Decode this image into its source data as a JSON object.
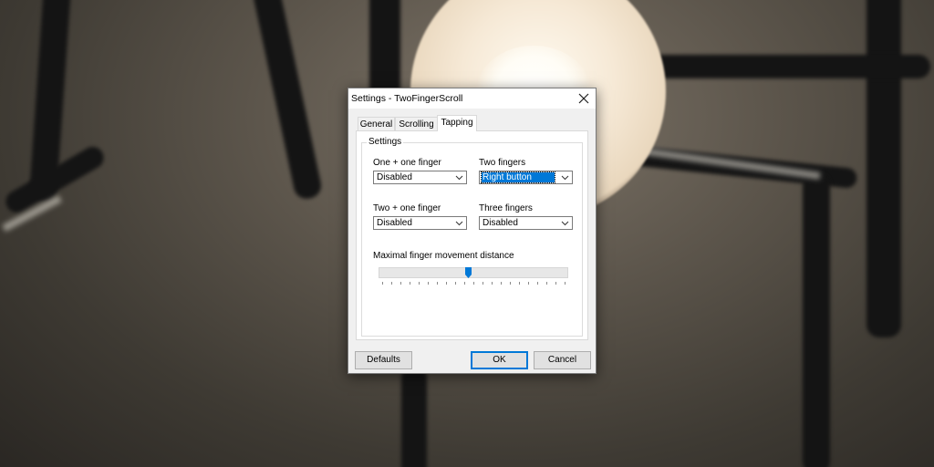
{
  "window": {
    "title": "Settings - TwoFingerScroll",
    "close_icon": "close-icon"
  },
  "tabs": [
    {
      "label": "General",
      "active": false
    },
    {
      "label": "Scrolling",
      "active": false
    },
    {
      "label": "Tapping",
      "active": true
    }
  ],
  "group": {
    "title": "Settings"
  },
  "fields": {
    "one_plus_one": {
      "label": "One + one finger",
      "value": "Disabled"
    },
    "two_fingers": {
      "label": "Two fingers",
      "value": "Right button"
    },
    "two_plus_one": {
      "label": "Two + one finger",
      "value": "Disabled"
    },
    "three_fingers": {
      "label": "Three fingers",
      "value": "Disabled"
    }
  },
  "slider": {
    "label": "Maximal finger movement distance",
    "position_fraction": 0.47,
    "tick_count": 21
  },
  "buttons": {
    "defaults": "Defaults",
    "ok": "OK",
    "cancel": "Cancel"
  },
  "colors": {
    "accent": "#0078d7",
    "dialog_bg": "#f0f0f0"
  }
}
